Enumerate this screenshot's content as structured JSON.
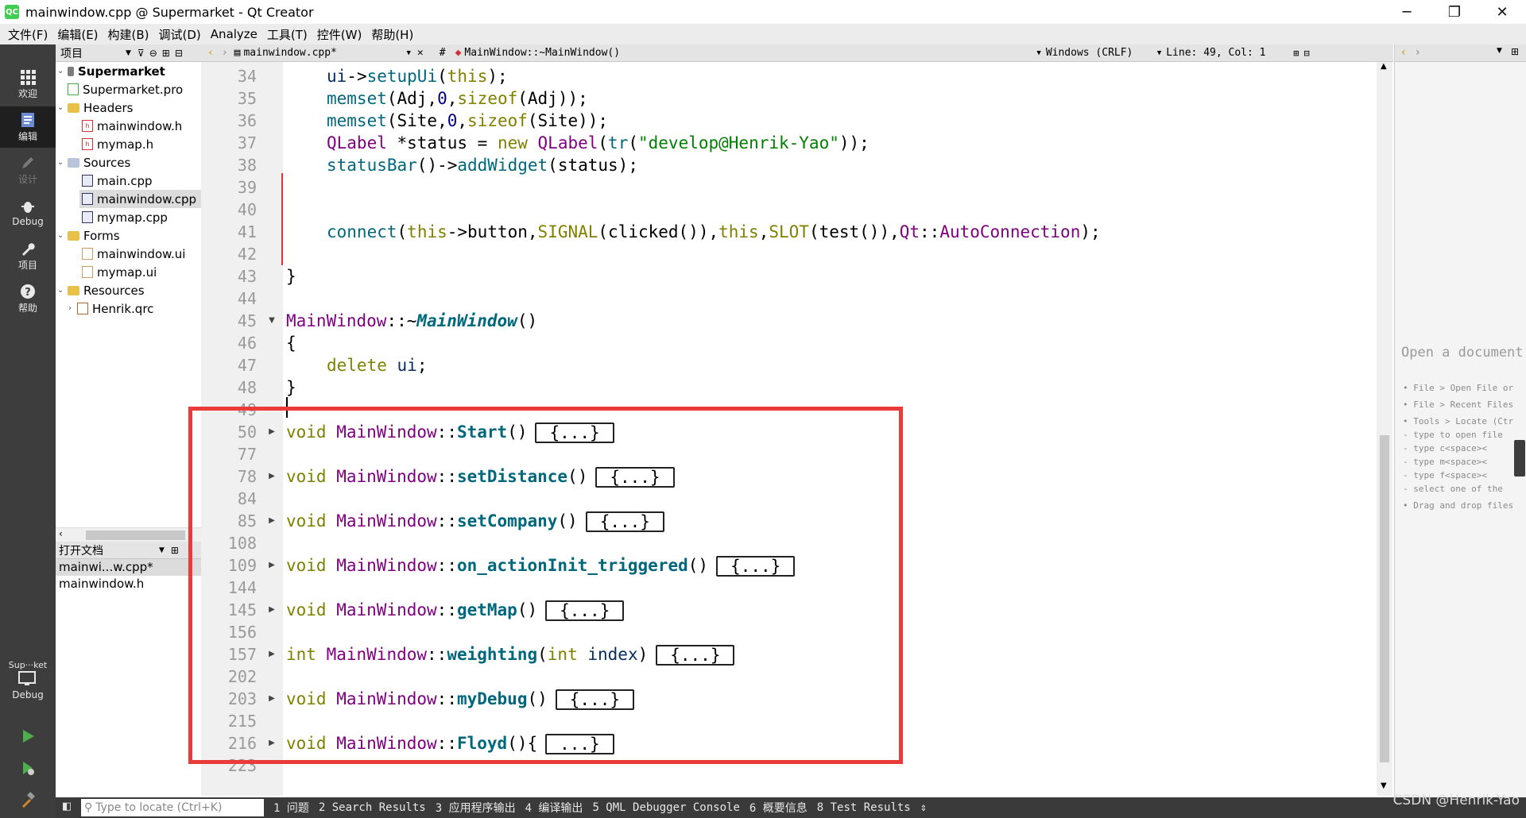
{
  "window": {
    "title": "mainwindow.cpp @ Supermarket - Qt Creator",
    "app_icon": "QC"
  },
  "menu": [
    "文件(F)",
    "编辑(E)",
    "构建(B)",
    "调试(D)",
    "Analyze",
    "工具(T)",
    "控件(W)",
    "帮助(H)"
  ],
  "modes": {
    "welcome": "欢迎",
    "edit": "编辑",
    "design": "设计",
    "debug": "Debug",
    "projects": "项目",
    "help": "帮助",
    "kit": "Sup···ket",
    "kit_mode": "Debug"
  },
  "project_pane": {
    "title": "项目"
  },
  "tree": [
    {
      "label": "Supermarket",
      "type": "project",
      "bold": true
    },
    {
      "label": "Supermarket.pro",
      "type": "pro"
    },
    {
      "label": "Headers",
      "type": "folder"
    },
    {
      "label": "mainwindow.h",
      "type": "h"
    },
    {
      "label": "mymap.h",
      "type": "h"
    },
    {
      "label": "Sources",
      "type": "folder"
    },
    {
      "label": "main.cpp",
      "type": "cpp"
    },
    {
      "label": "mainwindow.cpp",
      "type": "cpp"
    },
    {
      "label": "mymap.cpp",
      "type": "cpp"
    },
    {
      "label": "Forms",
      "type": "folder"
    },
    {
      "label": "mainwindow.ui",
      "type": "ui"
    },
    {
      "label": "mymap.ui",
      "type": "ui"
    },
    {
      "label": "Resources",
      "type": "folder"
    },
    {
      "label": "Henrik.qrc",
      "type": "qrc"
    }
  ],
  "open_docs": {
    "title": "打开文档",
    "items": [
      "mainwi...w.cpp*",
      "mainwindow.h"
    ]
  },
  "editor": {
    "file": "mainwindow.cpp*",
    "symbol": "MainWindow::~MainWindow()",
    "encoding": "Windows (CRLF)",
    "position": "Line: 49, Col: 1",
    "line_numbers": [
      "34",
      "35",
      "36",
      "37",
      "38",
      "39",
      "40",
      "41",
      "42",
      "43",
      "44",
      "45",
      "46",
      "47",
      "48",
      "49",
      "50",
      "77",
      "78",
      "84",
      "85",
      "108",
      "109",
      "144",
      "145",
      "156",
      "157",
      "202",
      "203",
      "215",
      "216",
      "223"
    ],
    "code": {
      "l34": [
        "ui",
        "->",
        "setupUi",
        "(",
        "this",
        ");"
      ],
      "l35": [
        "memset",
        "(Adj,",
        "0",
        ",",
        "sizeof",
        "(Adj));"
      ],
      "l36": [
        "memset",
        "(Site,",
        "0",
        ",",
        "sizeof",
        "(Site));"
      ],
      "l37": [
        "QLabel",
        " *status = ",
        "new",
        " ",
        "QLabel",
        "(",
        "tr",
        "(",
        "\"develop@Henrik-Yao\"",
        "));"
      ],
      "l38": [
        "statusBar",
        "()->",
        "addWidget",
        "(status);"
      ],
      "l41": [
        "connect",
        "(",
        "this",
        "->button,",
        "SIGNAL",
        "(clicked()),",
        "this",
        ",",
        "SLOT",
        "(test()),",
        "Qt",
        "::",
        "AutoConnection",
        ");"
      ],
      "l43": "}",
      "l45": [
        "MainWindow",
        "::~",
        "MainWindow",
        "()"
      ],
      "l46": "{",
      "l47": [
        "delete",
        " ",
        "ui",
        ";"
      ],
      "l48": "}",
      "f50": [
        "void",
        " ",
        "MainWindow",
        "::",
        "Start",
        "()"
      ],
      "f78": [
        "void",
        " ",
        "MainWindow",
        "::",
        "setDistance",
        "()"
      ],
      "f85": [
        "void",
        " ",
        "MainWindow",
        "::",
        "setCompany",
        "()"
      ],
      "f109": [
        "void",
        " ",
        "MainWindow",
        "::",
        "on_actionInit_triggered",
        "()"
      ],
      "f145": [
        "void",
        " ",
        "MainWindow",
        "::",
        "getMap",
        "()"
      ],
      "f157": [
        "int",
        " ",
        "MainWindow",
        "::",
        "weighting",
        "(",
        "int",
        " ",
        "index",
        ")"
      ],
      "f203": [
        "void",
        " ",
        "MainWindow",
        "::",
        "myDebug",
        "()"
      ],
      "f216": [
        "void",
        " ",
        "MainWindow",
        "::",
        "Floyd",
        "(){"
      ],
      "folded_marker": "{...}",
      "folded_marker_last": "...}"
    }
  },
  "right_pane": {
    "title": "Open a document",
    "hints": [
      "• File > Open File or",
      "• File > Recent Files",
      "• Tools > Locate (Ctr",
      "  - type to open file",
      "  - type c<space><",
      "  - type m<space><",
      "  - type f<space><",
      "  - select one of the",
      "• Drag and drop files"
    ]
  },
  "statusbar": {
    "locator_placeholder": "Type to locate (Ctrl+K)",
    "tabs": [
      "1 问题",
      "2 Search Results",
      "3 应用程序输出",
      "4 编译输出",
      "5 QML Debugger Console",
      "6 概要信息",
      "8 Test Results"
    ]
  },
  "watermark": "CSDN @Henrik-Yao",
  "colors": {
    "highlight_box": "#ea3b3b",
    "keyword": "#808000",
    "function": "#00677c",
    "class": "#800080",
    "string": "#008000"
  }
}
